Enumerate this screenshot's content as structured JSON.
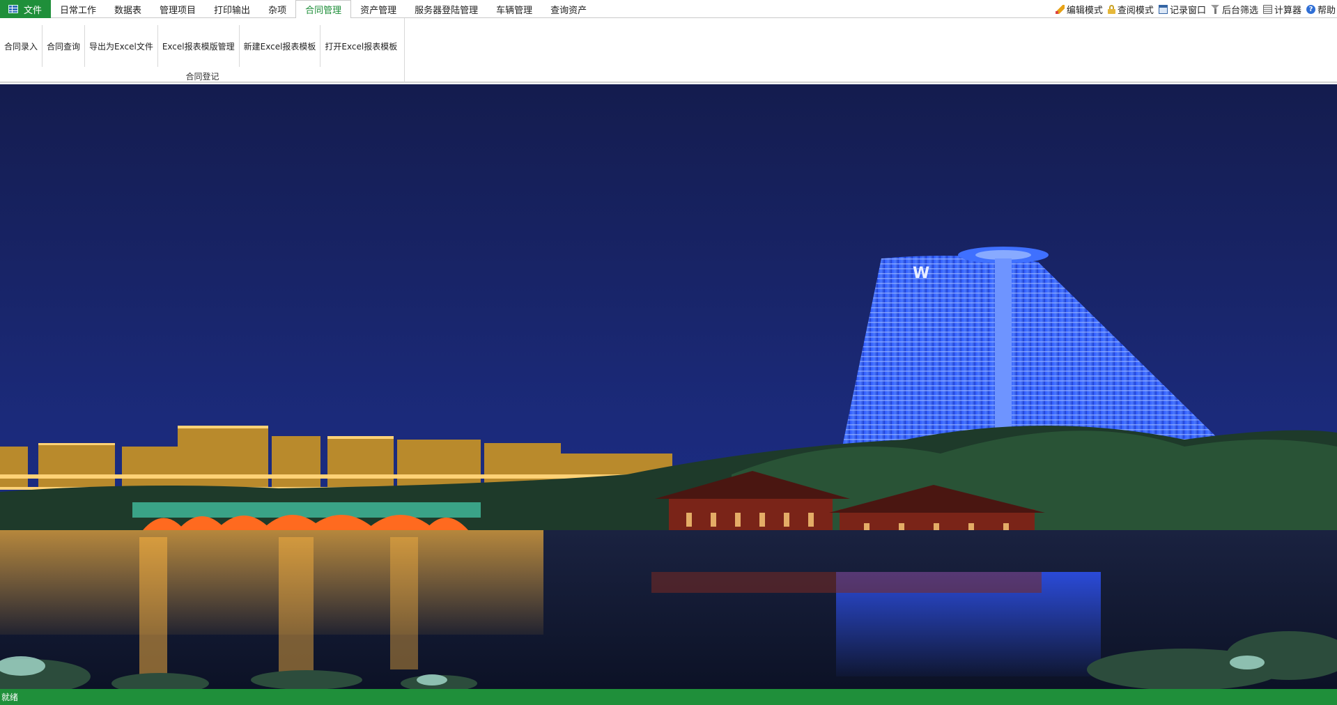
{
  "file_tab": {
    "label": "文件",
    "icon": "table-icon"
  },
  "tabs": [
    {
      "label": "日常工作",
      "active": false
    },
    {
      "label": "数据表",
      "active": false
    },
    {
      "label": "管理项目",
      "active": false
    },
    {
      "label": "打印输出",
      "active": false
    },
    {
      "label": "杂项",
      "active": false
    },
    {
      "label": "合同管理",
      "active": true
    },
    {
      "label": "资产管理",
      "active": false
    },
    {
      "label": "服务器登陆管理",
      "active": false
    },
    {
      "label": "车辆管理",
      "active": false
    },
    {
      "label": "查询资产",
      "active": false
    }
  ],
  "tools": [
    {
      "label": "编辑模式",
      "icon": "pencil-icon"
    },
    {
      "label": "查阅模式",
      "icon": "lock-icon"
    },
    {
      "label": "记录窗口",
      "icon": "window-icon"
    },
    {
      "label": "后台筛选",
      "icon": "filter-icon"
    },
    {
      "label": "计算器",
      "icon": "calculator-icon"
    },
    {
      "label": "帮助",
      "icon": "help-icon"
    }
  ],
  "ribbon": {
    "group_label": "合同登记",
    "buttons": [
      {
        "label": "合同录入"
      },
      {
        "label": "合同查询"
      },
      {
        "label": "导出为Excel文件"
      },
      {
        "label": "Excel报表模版管理"
      },
      {
        "label": "新建Excel报表模板"
      },
      {
        "label": "打开Excel报表模板"
      }
    ]
  },
  "background": {
    "description_icon": "night-cityscape-image",
    "sign_letter": "W"
  },
  "status": {
    "text": "就绪"
  },
  "colors": {
    "accent": "#1f8f3a",
    "sky": "#14205a",
    "building_glow": "#2a5cff"
  }
}
